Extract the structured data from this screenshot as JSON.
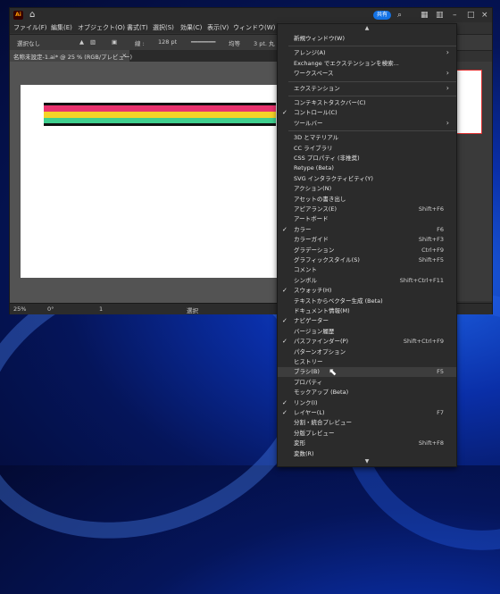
{
  "app": {
    "logo_text": "Ai",
    "share_label": "共有"
  },
  "menubar": [
    "ファイル(F)",
    "編集(E)",
    "オブジェクト(O)",
    "書式(T)",
    "選択(S)",
    "効果(C)",
    "表示(V)",
    "ウィンドウ(W)"
  ],
  "ctrlbar": {
    "selection": "選択なし",
    "stroke_label": "線 :",
    "stroke_value": "128 pt",
    "line_style": "均等",
    "weight_value": "3 pt. 丸"
  },
  "tab": {
    "title": "名称未設定-1.ai* @ 25 % (RGB/プレビュー)",
    "close": "×"
  },
  "status": {
    "zoom": "25%",
    "rotation": "0°",
    "page": "1",
    "tool": "選択"
  },
  "artwork": {
    "stripe_colors": [
      "#111111",
      "#e8336e",
      "#f5d328",
      "#3fcf8e",
      "#111111"
    ]
  },
  "dropdown": {
    "scroll_up": "▲",
    "scroll_down": "▼",
    "items": [
      {
        "label": "新規ウィンドウ(W)",
        "shortcut": "",
        "check": false,
        "submenu": false
      },
      {
        "sep": true
      },
      {
        "label": "アレンジ(A)",
        "shortcut": "",
        "check": false,
        "submenu": true
      },
      {
        "label": "Exchange でエクステンションを検索...",
        "shortcut": "",
        "check": false,
        "submenu": false
      },
      {
        "label": "ワークスペース",
        "shortcut": "",
        "check": false,
        "submenu": true
      },
      {
        "sep": true
      },
      {
        "label": "エクステンション",
        "shortcut": "",
        "check": false,
        "submenu": true
      },
      {
        "sep": true
      },
      {
        "label": "コンテキストタスクバー(C)",
        "shortcut": "",
        "check": false,
        "submenu": false
      },
      {
        "label": "コントロール(C)",
        "shortcut": "",
        "check": true,
        "submenu": false
      },
      {
        "label": "ツールバー",
        "shortcut": "",
        "check": false,
        "submenu": true
      },
      {
        "sep": true
      },
      {
        "label": "3D とマテリアル",
        "shortcut": "",
        "check": false,
        "submenu": false
      },
      {
        "label": "CC ライブラリ",
        "shortcut": "",
        "check": false,
        "submenu": false
      },
      {
        "label": "CSS プロパティ (非推奨)",
        "shortcut": "",
        "check": false,
        "submenu": false
      },
      {
        "label": "Retype (Beta)",
        "shortcut": "",
        "check": false,
        "submenu": false
      },
      {
        "label": "SVG インタラクティビティ(Y)",
        "shortcut": "",
        "check": false,
        "submenu": false
      },
      {
        "label": "アクション(N)",
        "shortcut": "",
        "check": false,
        "submenu": false
      },
      {
        "label": "アセットの書き出し",
        "shortcut": "",
        "check": false,
        "submenu": false
      },
      {
        "label": "アピアランス(E)",
        "shortcut": "Shift+F6",
        "check": false,
        "submenu": false
      },
      {
        "label": "アートボード",
        "shortcut": "",
        "check": false,
        "submenu": false
      },
      {
        "label": "カラー",
        "shortcut": "F6",
        "check": true,
        "submenu": false
      },
      {
        "label": "カラーガイド",
        "shortcut": "Shift+F3",
        "check": false,
        "submenu": false
      },
      {
        "label": "グラデーション",
        "shortcut": "Ctrl+F9",
        "check": false,
        "submenu": false
      },
      {
        "label": "グラフィックスタイル(S)",
        "shortcut": "Shift+F5",
        "check": false,
        "submenu": false
      },
      {
        "label": "コメント",
        "shortcut": "",
        "check": false,
        "submenu": false
      },
      {
        "label": "シンボル",
        "shortcut": "Shift+Ctrl+F11",
        "check": false,
        "submenu": false
      },
      {
        "label": "スウォッチ(H)",
        "shortcut": "",
        "check": true,
        "submenu": false
      },
      {
        "label": "テキストからベクター生成 (Beta)",
        "shortcut": "",
        "check": false,
        "submenu": false
      },
      {
        "label": "ドキュメント情報(M)",
        "shortcut": "",
        "check": false,
        "submenu": false
      },
      {
        "label": "ナビゲーター",
        "shortcut": "",
        "check": true,
        "submenu": false
      },
      {
        "label": "バージョン履歴",
        "shortcut": "",
        "check": false,
        "submenu": false
      },
      {
        "label": "パスファインダー(P)",
        "shortcut": "Shift+Ctrl+F9",
        "check": true,
        "submenu": false
      },
      {
        "label": "パターンオプション",
        "shortcut": "",
        "check": false,
        "submenu": false
      },
      {
        "label": "ヒストリー",
        "shortcut": "",
        "check": false,
        "submenu": false
      },
      {
        "label": "ブラシ(B)",
        "shortcut": "F5",
        "check": false,
        "submenu": false,
        "hover": true
      },
      {
        "label": "プロパティ",
        "shortcut": "",
        "check": false,
        "submenu": false
      },
      {
        "label": "モックアップ (Beta)",
        "shortcut": "",
        "check": false,
        "submenu": false
      },
      {
        "label": "リンク(I)",
        "shortcut": "",
        "check": true,
        "submenu": false
      },
      {
        "label": "レイヤー(L)",
        "shortcut": "F7",
        "check": true,
        "submenu": false
      },
      {
        "label": "分割・統合プレビュー",
        "shortcut": "",
        "check": false,
        "submenu": false
      },
      {
        "label": "分版プレビュー",
        "shortcut": "",
        "check": false,
        "submenu": false
      },
      {
        "label": "変形",
        "shortcut": "Shift+F8",
        "check": false,
        "submenu": false
      },
      {
        "label": "変数(R)",
        "shortcut": "",
        "check": false,
        "submenu": false
      }
    ]
  }
}
